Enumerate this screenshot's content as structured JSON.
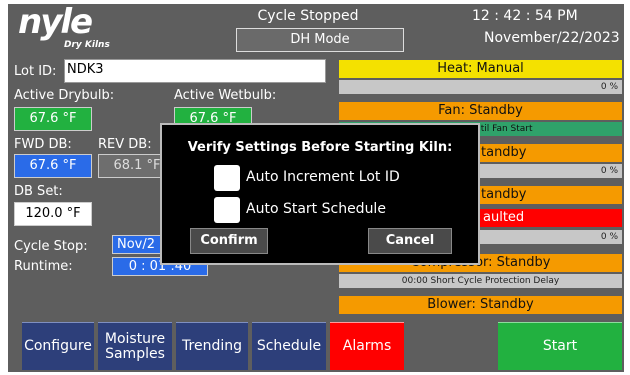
{
  "header": {
    "logo_text": "nyle",
    "logo_sub": "Dry Kilns",
    "cycle_status": "Cycle Stopped",
    "mode": "DH Mode",
    "clock": "12 : 42 : 54  PM",
    "date": "November/22/2023"
  },
  "left": {
    "lot_id_label": "Lot ID:",
    "lot_id_value": "NDK3",
    "active_drybulb_label": "Active Drybulb:",
    "active_drybulb_value": "67.6 °F",
    "active_wetbulb_label": "Active Wetbulb:",
    "active_wetbulb_value": "67.6 °F",
    "fwd_db_label": "FWD DB:",
    "fwd_db_value": "67.6 °F",
    "rev_db_label": "REV DB:",
    "rev_db_value": "68.1 °F",
    "db_set_label": "DB Set:",
    "db_set_value": "120.0 °F",
    "cycle_stop_label": "Cycle Stop:",
    "cycle_stop_value": "Nov/2",
    "runtime_label": "Runtime:",
    "runtime_value": "0 : 01 :40"
  },
  "right": {
    "heat_label": "Heat: Manual",
    "heat_percent": "0 %",
    "fan_label": "Fan: Standby",
    "fan_sub": "ntil Fan Start",
    "vent_label": "tandby",
    "vent_percent": "0 %",
    "spray_label": "tandby",
    "fault_label": "aulted",
    "fault_percent": "0 %",
    "compressor_label": "Compressor: Standby",
    "compressor_sub": "00:00 Short Cycle Protection Delay",
    "blower_label": "Blower: Standby",
    "colors": {
      "heat": "#f4e100",
      "standby": "#f59a00",
      "fault": "#ff0000",
      "fan_sub": "#2fa26a"
    }
  },
  "nav": {
    "configure": "Configure",
    "moisture_samples": "Moisture Samples",
    "trending": "Trending",
    "schedule": "Schedule",
    "alarms": "Alarms",
    "start": "Start"
  },
  "modal": {
    "title": "Verify Settings Before Starting Kiln:",
    "auto_increment_label": "Auto Increment Lot ID",
    "auto_start_label": "Auto Start Schedule",
    "confirm": "Confirm",
    "cancel": "Cancel"
  }
}
